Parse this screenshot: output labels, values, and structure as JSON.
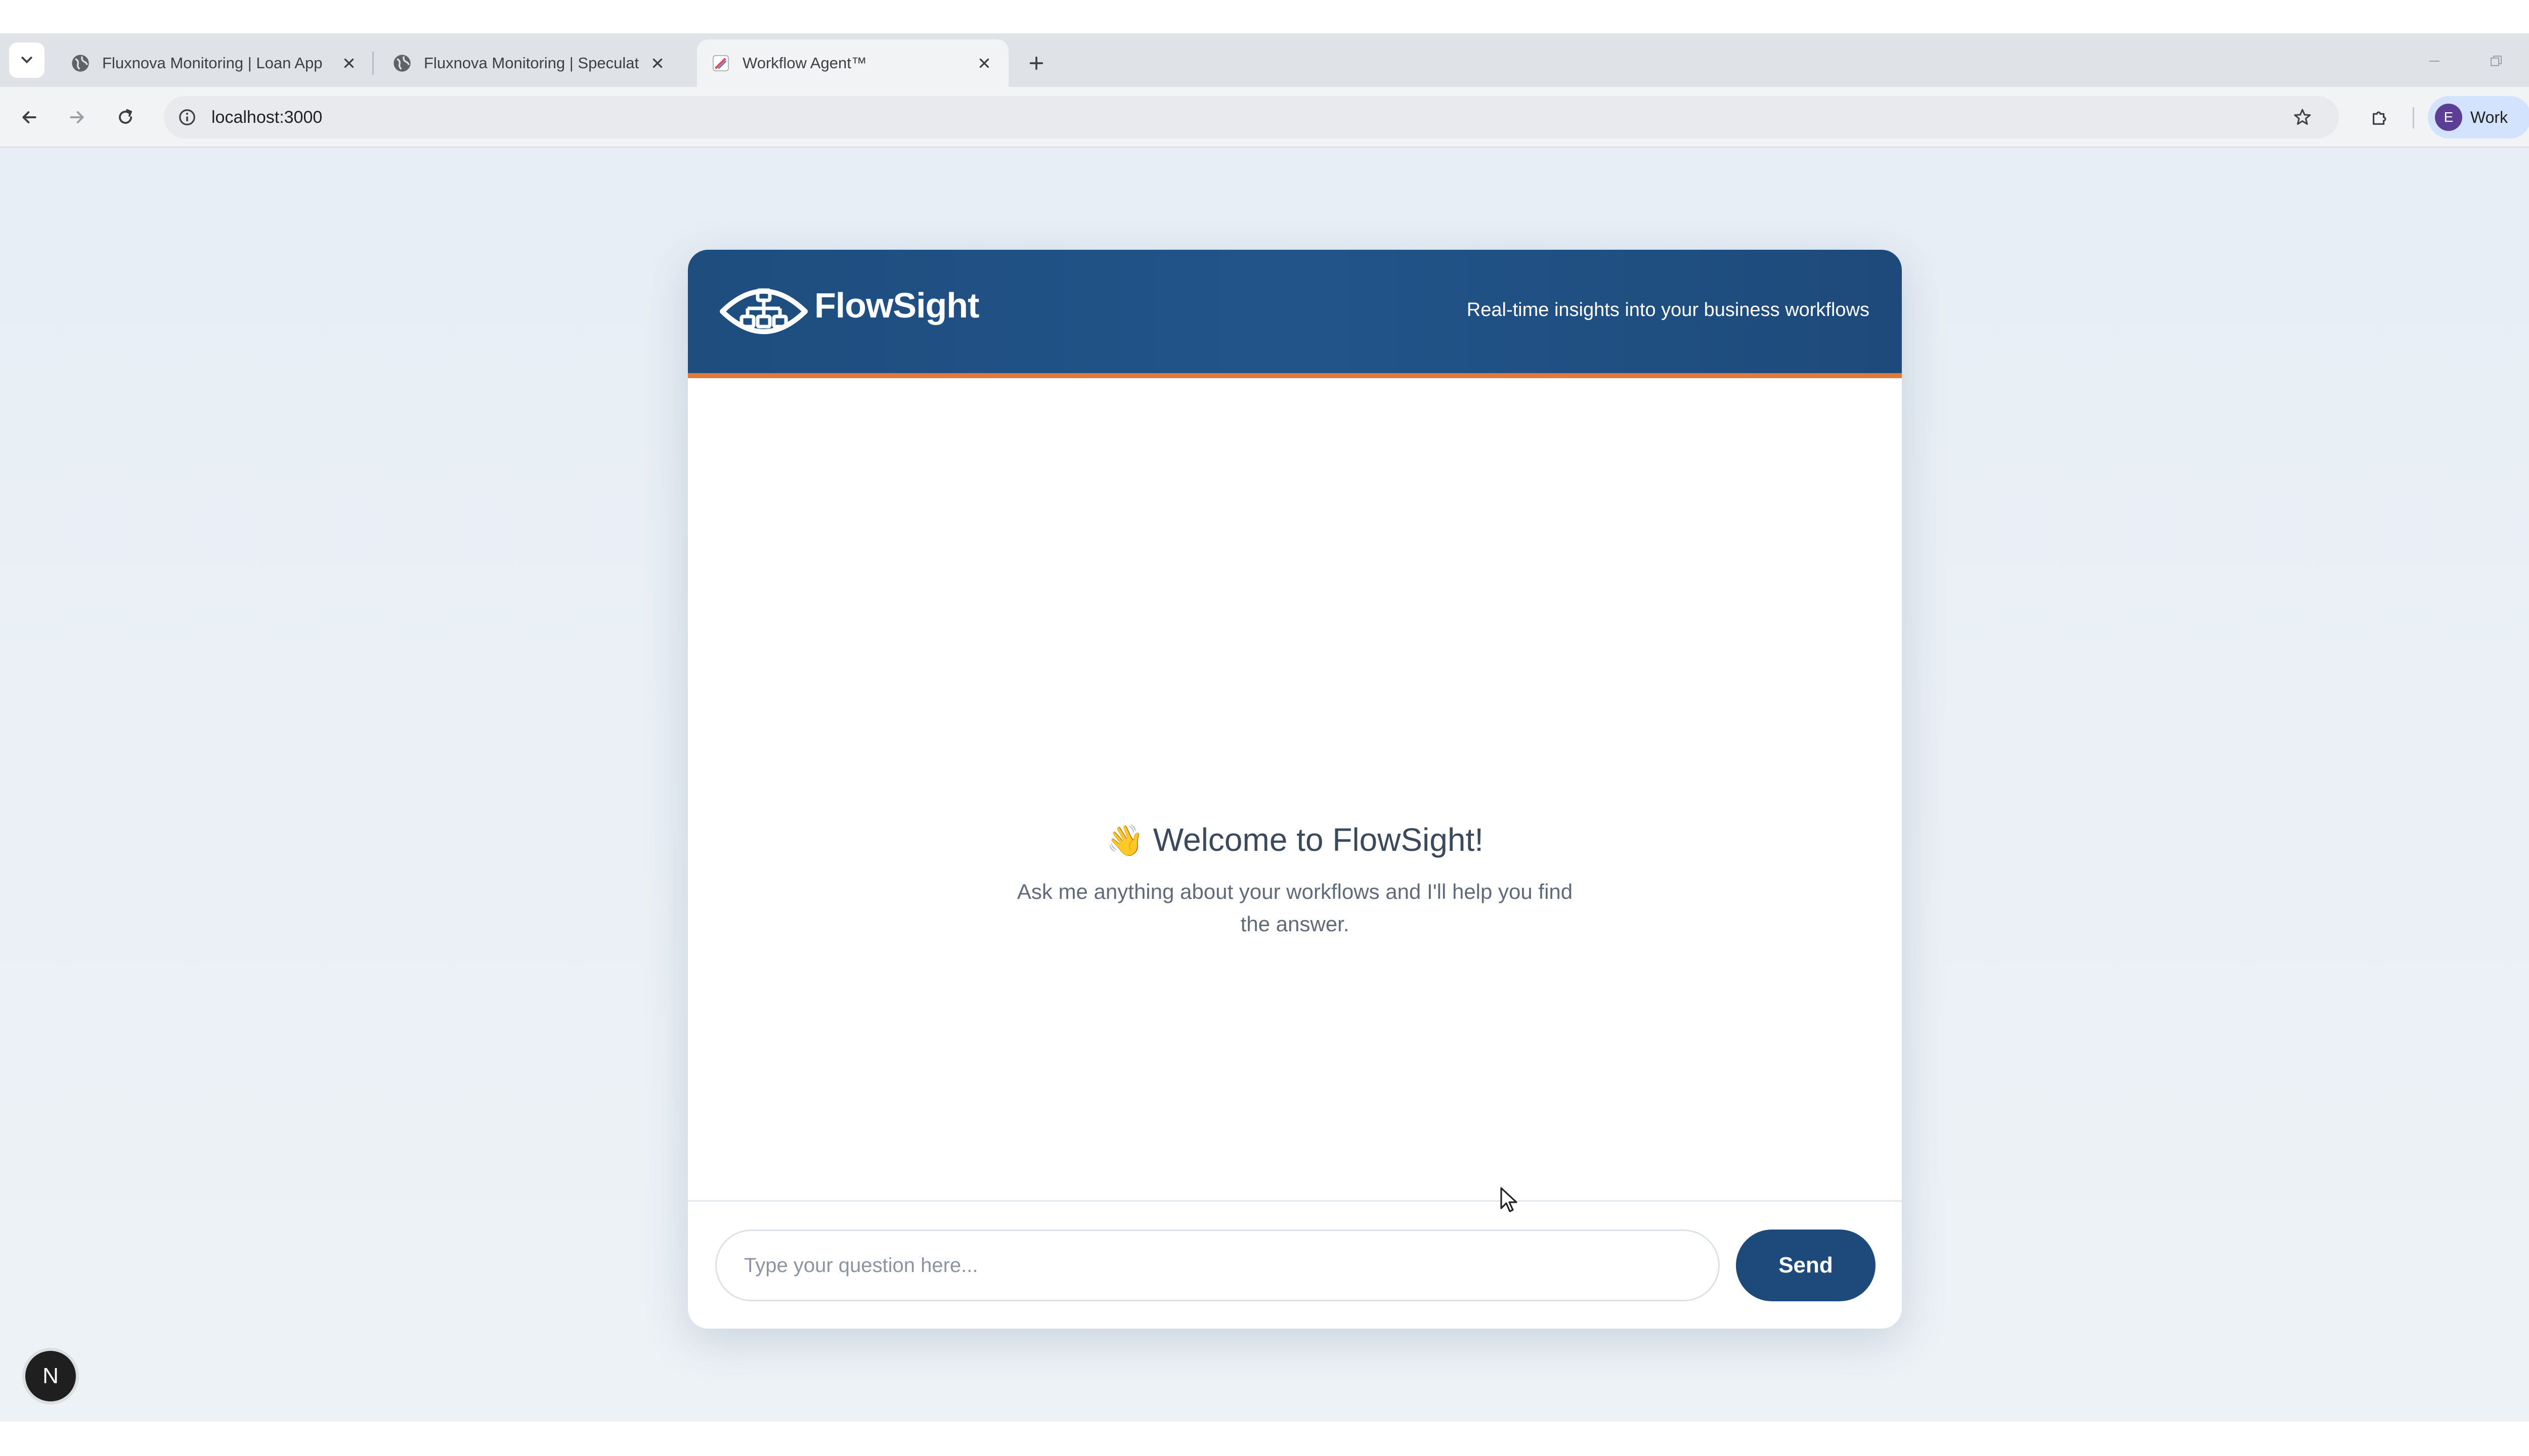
{
  "browser": {
    "tabs": [
      {
        "title": "Fluxnova Monitoring | Loan App",
        "icon": "globe-icon",
        "active": false
      },
      {
        "title": "Fluxnova Monitoring | Speculat",
        "icon": "globe-icon",
        "active": false
      },
      {
        "title": "Workflow Agent™",
        "icon": "pen-icon",
        "active": true
      }
    ],
    "url": "localhost:3000",
    "profile": {
      "initial": "E",
      "label": "Work"
    }
  },
  "app": {
    "brand": "FlowSight",
    "tagline": "Real-time insights into your business workflows",
    "welcome": {
      "emoji": "👋",
      "title": "Welcome to FlowSight!",
      "description": "Ask me anything about your workflows and I'll help you find the answer."
    },
    "composer": {
      "placeholder": "Type your question here...",
      "send_label": "Send"
    }
  },
  "devtools": {
    "badge": "N"
  },
  "colors": {
    "header_blue": "#1e4d7e",
    "accent_orange": "#e4783a",
    "send_button": "#1d4a7a"
  }
}
